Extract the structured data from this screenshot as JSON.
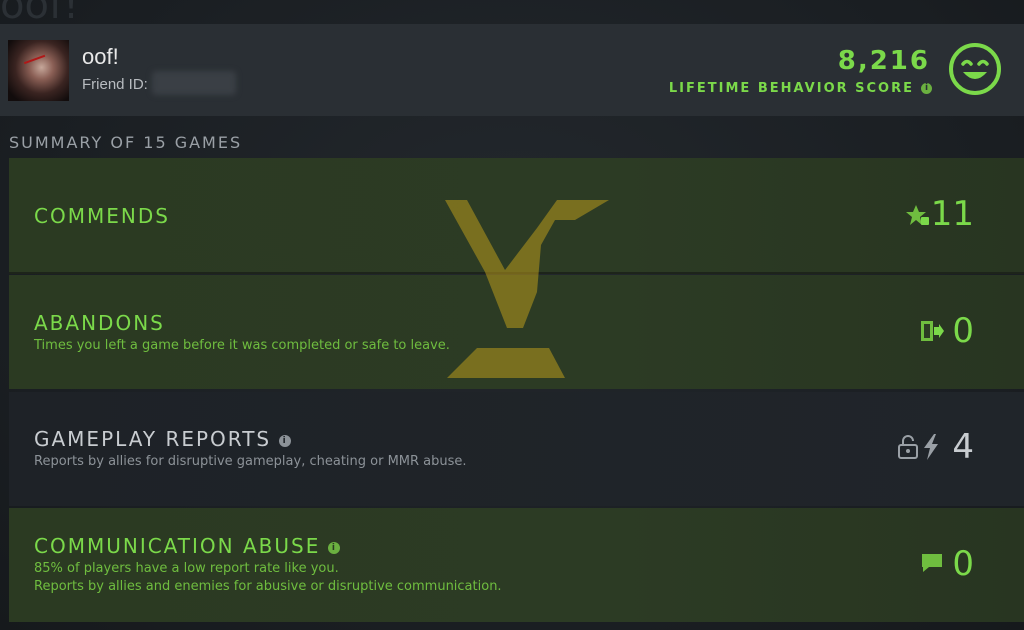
{
  "header": {
    "ghost_title": "oof!",
    "username": "oof!",
    "friend_id_label": "Friend ID:",
    "avatar_icon": "profile-avatar",
    "score_value": "8,216",
    "score_label": "LIFETIME BEHAVIOR SCORE",
    "score_info_glyph": "i",
    "smiley_icon": "smiley-face-icon"
  },
  "summary": {
    "title": "SUMMARY OF 15 GAMES",
    "rows": [
      {
        "title": "COMMENDS",
        "subtitle": "",
        "value": "11",
        "icon": "star-thumb-icon"
      },
      {
        "title": "ABANDONS",
        "subtitle": "Times you left a game before it was completed or safe to leave.",
        "value": "0",
        "icon": "exit-door-icon"
      },
      {
        "title": "GAMEPLAY REPORTS",
        "subtitle": "Reports by allies for disruptive gameplay, cheating or MMR abuse.",
        "value": "4",
        "icon": "lock-lightning-icon",
        "info_glyph": "i"
      },
      {
        "title": "COMMUNICATION ABUSE",
        "subtitle": "85% of players have a low report rate like you.",
        "subtitle2": "Reports by allies and enemies for abusive or disruptive communication.",
        "value": "0",
        "icon": "chat-bubble-icon",
        "info_glyph": "i"
      }
    ]
  },
  "colors": {
    "accent_green": "#7bd94a",
    "header_bg": "#2a2f34",
    "row_green_bg": "#2c3b24",
    "row_dark_bg": "#20252a",
    "logo_gold": "#b89a1c"
  }
}
